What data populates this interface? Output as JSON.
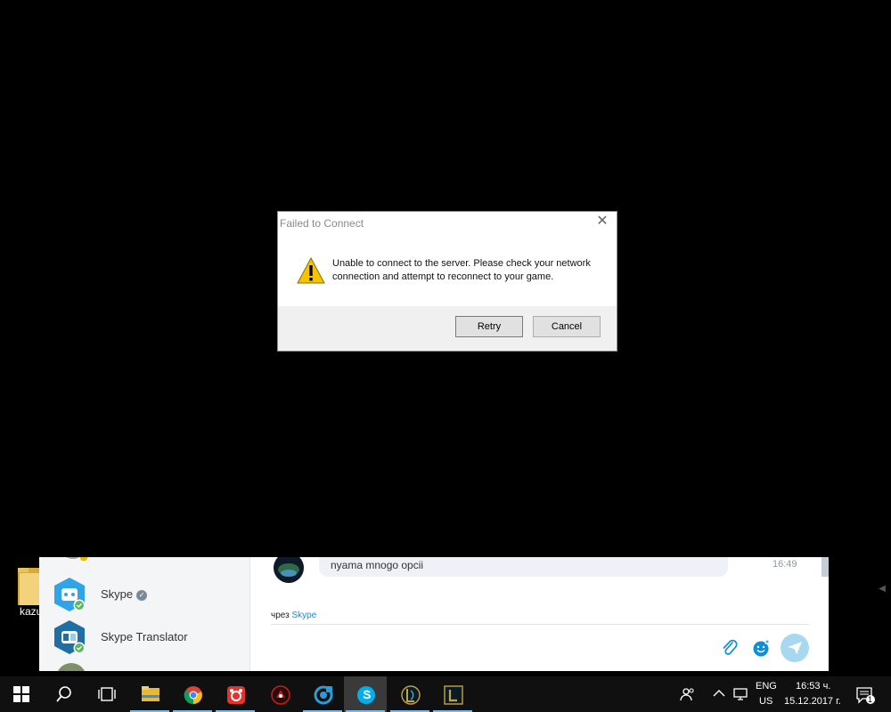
{
  "dialog": {
    "title": "Failed to Connect",
    "message": "Unable to connect to the server. Please check your network connection and attempt to reconnect to your game.",
    "retry_label": "Retry",
    "cancel_label": "Cancel",
    "close_glyph": "✕"
  },
  "desktop": {
    "icon_label": "kazu",
    "scroll_arrow": "◀"
  },
  "skype": {
    "contacts": [
      {
        "name": "Skype",
        "verified_glyph": "✓"
      },
      {
        "name": "Skype Translator"
      }
    ],
    "message": {
      "text": "nyama mnogo opcii",
      "time": "16:49"
    },
    "via_prefix": "чрез",
    "via_link": "Skype",
    "compose_placeholder": ""
  },
  "taskbar": {
    "apps": [
      "start-icon",
      "search-icon",
      "task-view-icon",
      "file-explorer-icon",
      "chrome-icon",
      "app-red-icon",
      "app-dark-red-icon",
      "ccleaner-icon",
      "skype-icon",
      "league-icon",
      "league-client-icon"
    ],
    "lang_top": "ENG",
    "lang_bottom": "US",
    "time": "16:53 ч.",
    "date": "15.12.2017 г.",
    "notification_count": "1"
  },
  "colors": {
    "accent": "#0e8fd6",
    "send_button": "#a8d8f0",
    "taskbar": "#101010",
    "dialog_footer": "#f0f0f0"
  }
}
